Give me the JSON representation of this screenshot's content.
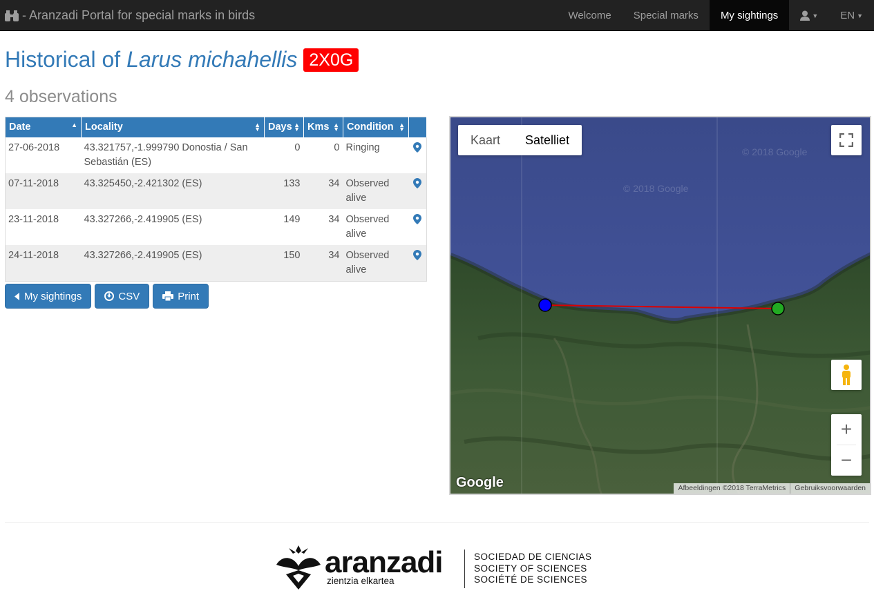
{
  "navbar": {
    "brand": "- Aranzadi Portal for special marks in birds",
    "items": [
      {
        "label": "Welcome"
      },
      {
        "label": "Special marks"
      },
      {
        "label": "My sightings"
      }
    ],
    "language": "EN"
  },
  "heading": {
    "prefix": "Historical of",
    "species": "Larus michahellis",
    "mark": "2X0G",
    "mark_color": "#ff0000"
  },
  "subheading": "4 observations",
  "table": {
    "columns": [
      "Date",
      "Locality",
      "Days",
      "Kms",
      "Condition"
    ],
    "rows": [
      {
        "date": "27-06-2018",
        "locality": "43.321757,-1.999790 Donostia / San Sebastián (ES)",
        "days": "0",
        "kms": "0",
        "condition": "Ringing"
      },
      {
        "date": "07-11-2018",
        "locality": "43.325450,-2.421302 (ES)",
        "days": "133",
        "kms": "34",
        "condition": "Observed alive"
      },
      {
        "date": "23-11-2018",
        "locality": "43.327266,-2.419905 (ES)",
        "days": "149",
        "kms": "34",
        "condition": "Observed alive"
      },
      {
        "date": "24-11-2018",
        "locality": "43.327266,-2.419905 (ES)",
        "days": "150",
        "kms": "34",
        "condition": "Observed alive"
      }
    ]
  },
  "buttons": {
    "back": "My sightings",
    "csv": "CSV",
    "print": "Print"
  },
  "map": {
    "type_map": "Kaart",
    "type_satellite": "Satelliet",
    "google": "Google",
    "attribution": "Afbeeldingen ©2018 TerraMetrics",
    "terms": "Gebruiksvoorwaarden",
    "watermark": "© 2018 Google",
    "zoom_in": "+",
    "zoom_out": "−",
    "start_marker_color": "#0000ff",
    "end_marker_color": "#22aa22",
    "route_color": "#dd0000"
  },
  "footer": {
    "logo": "aranzadi",
    "logo_sub": "zientzia elkartea",
    "lines": [
      "SOCIEDAD DE CIENCIAS",
      "SOCIETY OF SCIENCES",
      "SOCIÉTÉ DE SCIENCES"
    ]
  }
}
